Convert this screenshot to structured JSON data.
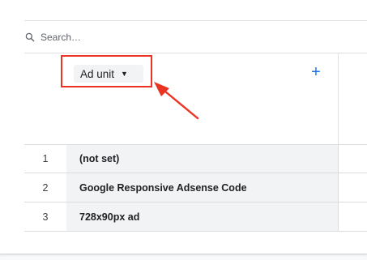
{
  "search": {
    "placeholder": "Search…"
  },
  "dimension": {
    "label": "Ad unit"
  },
  "add_button": {
    "label": "+"
  },
  "rows": [
    {
      "index": "1",
      "value": "(not set)"
    },
    {
      "index": "2",
      "value": "Google Responsive Adsense Code"
    },
    {
      "index": "3",
      "value": "728x90px ad"
    }
  ],
  "colors": {
    "accent": "#1a73e8",
    "annotation": "#ea3323",
    "cell_bg": "#f1f3f4"
  },
  "icons": {
    "search": "search-icon",
    "dropdown": "caret-down-icon",
    "annotation": "arrow-annotation"
  }
}
